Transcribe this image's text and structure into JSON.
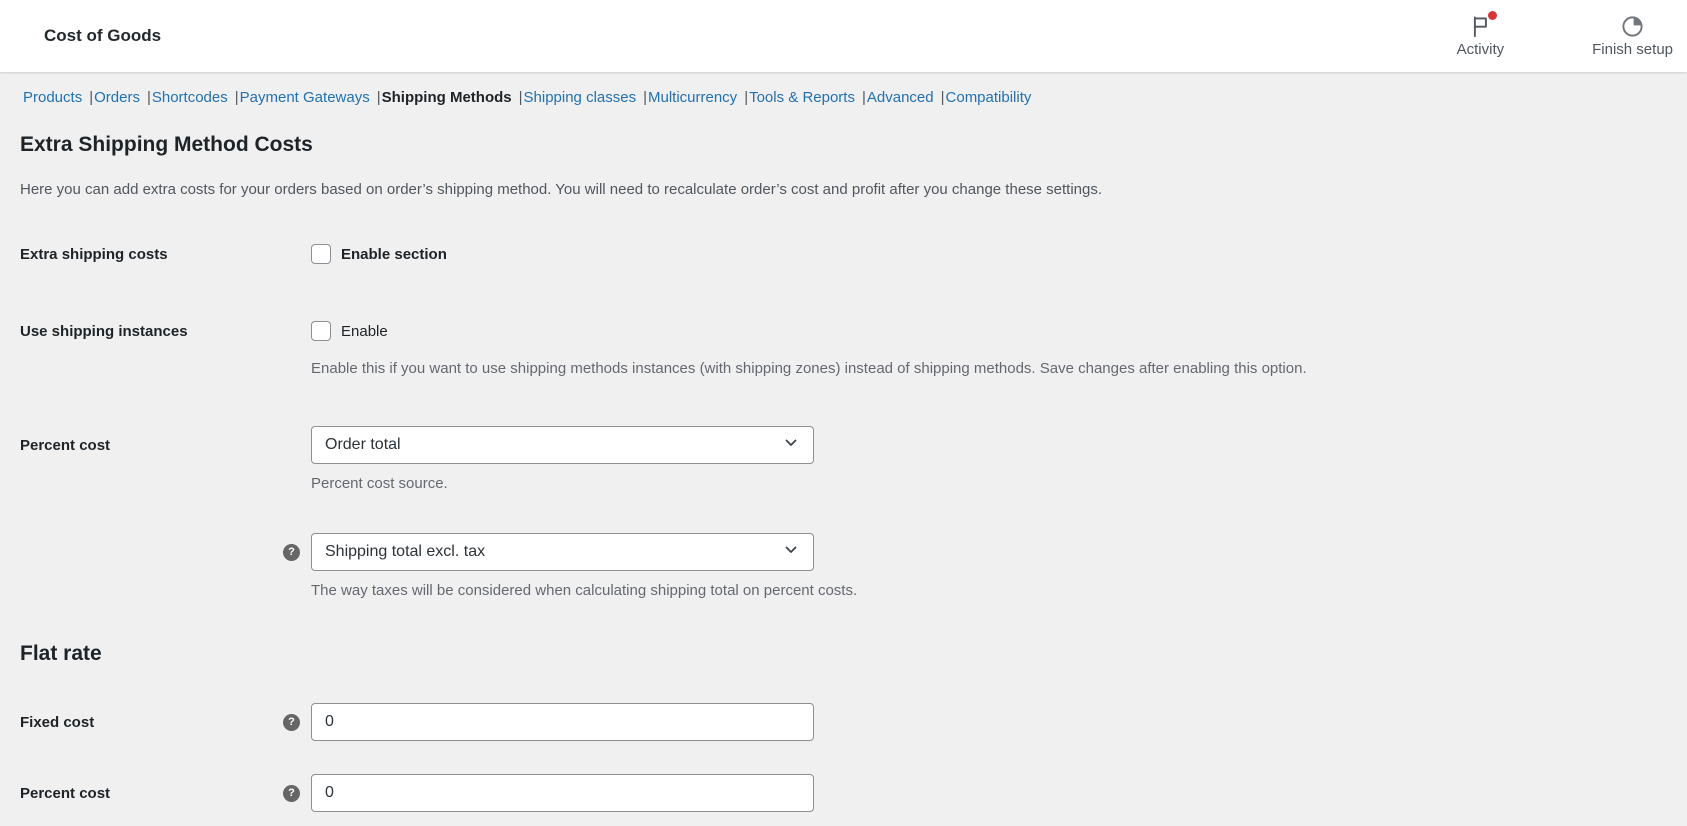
{
  "header": {
    "title": "Cost of Goods",
    "activity_label": "Activity",
    "finish_setup_label": "Finish setup"
  },
  "nav": {
    "separator": "|",
    "items": [
      {
        "label": "Products",
        "active": false
      },
      {
        "label": "Orders",
        "active": false
      },
      {
        "label": "Shortcodes",
        "active": false
      },
      {
        "label": "Payment Gateways",
        "active": false
      },
      {
        "label": "Shipping Methods",
        "active": true
      },
      {
        "label": "Shipping classes",
        "active": false
      },
      {
        "label": "Multicurrency",
        "active": false
      },
      {
        "label": "Tools & Reports",
        "active": false
      },
      {
        "label": "Advanced",
        "active": false
      },
      {
        "label": "Compatibility",
        "active": false
      }
    ]
  },
  "page": {
    "title": "Extra Shipping Method Costs",
    "description": "Here you can add extra costs for your orders based on order’s shipping method. You will need to recalculate order’s cost and profit after you change these settings."
  },
  "form": {
    "extra_shipping_costs": {
      "label": "Extra shipping costs",
      "checkbox_label": "Enable section",
      "checked": false
    },
    "use_shipping_instances": {
      "label": "Use shipping instances",
      "checkbox_label": "Enable",
      "checked": false,
      "description": "Enable this if you want to use shipping methods instances (with shipping zones) instead of shipping methods. Save changes after enabling this option."
    },
    "percent_cost_source": {
      "label": "Percent cost",
      "value": "Order total",
      "description": "Percent cost source."
    },
    "shipping_tax": {
      "value": "Shipping total excl. tax",
      "description": "The way taxes will be considered when calculating shipping total on percent costs."
    },
    "flat_rate": {
      "title": "Flat rate",
      "fixed_cost": {
        "label": "Fixed cost",
        "value": "0"
      },
      "percent_cost": {
        "label": "Percent cost",
        "value": "0"
      }
    }
  },
  "icons": {
    "help_glyph": "?"
  },
  "colors": {
    "link_blue": "#2271b1",
    "heading": "#1d2327",
    "description_gray": "#646970",
    "field_border": "#8c8f94",
    "notification_dot": "#d63638",
    "icon_gray": "#646970",
    "page_background": "#f0f0f1",
    "surface": "#ffffff"
  }
}
